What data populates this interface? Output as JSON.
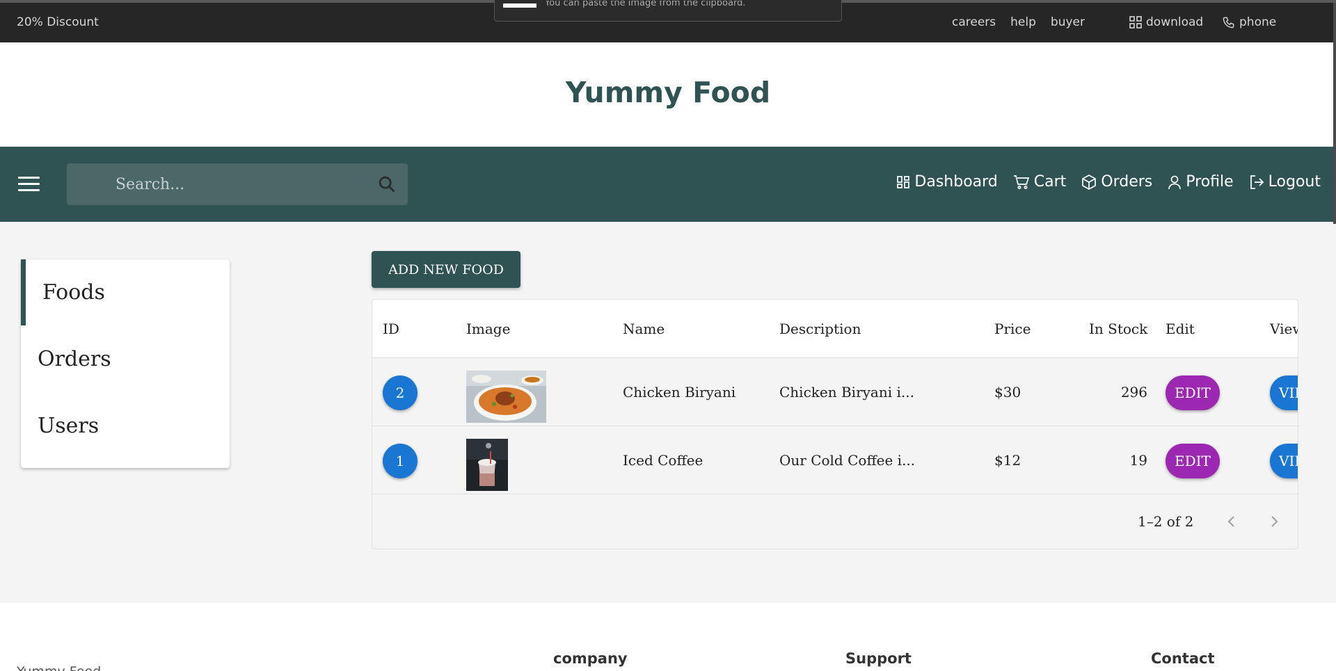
{
  "topbar": {
    "discount": "20% Discount",
    "links": [
      "careers",
      "help",
      "buyer"
    ],
    "download": "download",
    "phone": "phone",
    "toast_text": "You can paste the image from the clipboard."
  },
  "brand": {
    "title": "Yummy Food"
  },
  "nav": {
    "search_placeholder": "Search...",
    "links": [
      {
        "label": "Dashboard",
        "icon": "dashboard-icon"
      },
      {
        "label": "Cart",
        "icon": "cart-icon"
      },
      {
        "label": "Orders",
        "icon": "box-icon"
      },
      {
        "label": "Profile",
        "icon": "user-icon"
      },
      {
        "label": "Logout",
        "icon": "logout-icon"
      }
    ]
  },
  "sidebar": {
    "items": [
      {
        "label": "Foods",
        "active": true
      },
      {
        "label": "Orders",
        "active": false
      },
      {
        "label": "Users",
        "active": false
      }
    ]
  },
  "main": {
    "add_button": "ADD NEW FOOD",
    "columns": [
      "ID",
      "Image",
      "Name",
      "Description",
      "Price",
      "In Stock",
      "Edit",
      "View"
    ],
    "rows": [
      {
        "id": "2",
        "name": "Chicken Biryani",
        "description": "Chicken Biryani i...",
        "price": "$30",
        "stock": "296",
        "edit": "EDIT",
        "view": "VIEW"
      },
      {
        "id": "1",
        "name": "Iced Coffee",
        "description": "Our Cold Coffee i...",
        "price": "$12",
        "stock": "19",
        "edit": "EDIT",
        "view": "VIEW"
      }
    ],
    "pagination": "1–2 of 2"
  },
  "footer": {
    "brand": "Yummy Food",
    "headings": [
      "company",
      "Support",
      "Contact"
    ]
  },
  "colors": {
    "primary": "#2f5252",
    "topbar": "#262626",
    "edit": "#9c27b0",
    "blue": "#1976d2"
  }
}
